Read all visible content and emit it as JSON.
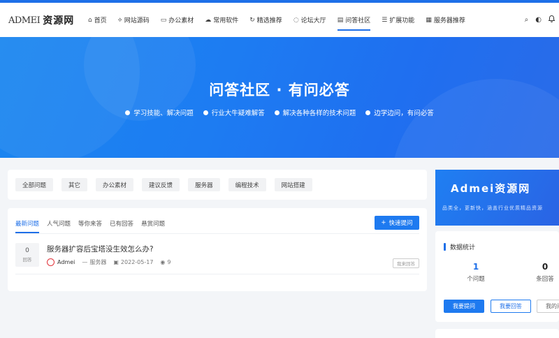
{
  "header": {
    "logo_en": "ADMEI",
    "logo_cn": "资源网",
    "nav": [
      {
        "icon": "home-icon",
        "glyph": "⌂",
        "label": "首页"
      },
      {
        "icon": "code-icon",
        "glyph": "⟡",
        "label": "网站源码"
      },
      {
        "icon": "folder-icon",
        "glyph": "▭",
        "label": "办公素材"
      },
      {
        "icon": "cloud-icon",
        "glyph": "☁",
        "label": "常用软件"
      },
      {
        "icon": "refresh-icon",
        "glyph": "↻",
        "label": "精选推荐"
      },
      {
        "icon": "forum-icon",
        "glyph": "◌",
        "label": "论坛大厅"
      },
      {
        "icon": "book-icon",
        "glyph": "▤",
        "label": "问答社区",
        "active": true
      },
      {
        "icon": "grid-icon",
        "glyph": "☰",
        "label": "扩展功能"
      },
      {
        "icon": "windows-icon",
        "glyph": "▦",
        "label": "服务器推荐"
      }
    ],
    "tools": {
      "search": "⌕",
      "theme": "◐",
      "bell": "🔔"
    }
  },
  "hero": {
    "title": "问答社区 · 有问必答",
    "points": [
      "学习技能、解决问题",
      "行业大牛疑难解答",
      "解决各种各样的技术问题",
      "边学边问，有问必答"
    ]
  },
  "categories": [
    "全部问题",
    "其它",
    "办公素材",
    "建议反馈",
    "服务器",
    "编程技术",
    "网站搭建"
  ],
  "questions_panel": {
    "tabs": [
      "最新问题",
      "人气问题",
      "等你来答",
      "已有回答",
      "悬赏问题"
    ],
    "ask_button": "快速提问",
    "ask_icon": "+",
    "items": [
      {
        "answers": "0",
        "answers_label": "回答",
        "title": "服务器扩容后宝塔没生效怎么办?",
        "author": "Admei",
        "category": "服务器",
        "date": "2022-05-17",
        "views": "9",
        "answer_button": "我来回答"
      }
    ]
  },
  "sidebar": {
    "banner_title": "Admei资源网",
    "banner_sub": "品类全，更新快，涵盖行业优质精品资源",
    "stats_title": "数据统计",
    "stats": [
      {
        "value": "1",
        "label": "个问题"
      },
      {
        "value": "0",
        "label": "条回答"
      }
    ],
    "buttons": [
      "我要提问",
      "我要回答",
      "我的问"
    ]
  },
  "colors": {
    "accent": "#1e6fe8",
    "hero_start": "#1a86f0",
    "hero_end": "#2a6be8"
  }
}
